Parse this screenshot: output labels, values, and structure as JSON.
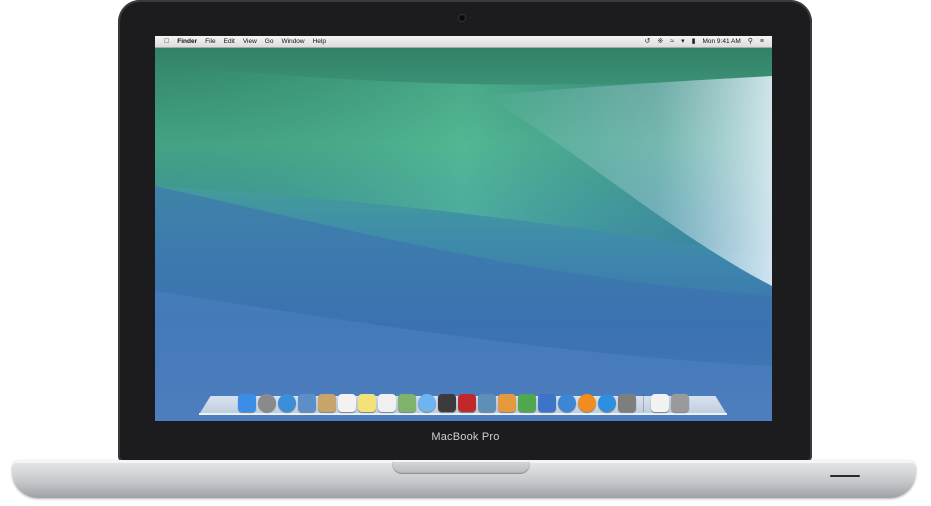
{
  "device": {
    "brand_label": "MacBook Pro"
  },
  "menubar": {
    "apple_icon": "apple-icon",
    "app_name": "Finder",
    "menus": [
      "File",
      "Edit",
      "View",
      "Go",
      "Window",
      "Help"
    ],
    "status_icons": [
      "time-machine-icon",
      "bluetooth-icon",
      "wifi-icon",
      "volume-icon",
      "battery-icon"
    ],
    "clock": "Mon 9:41 AM",
    "spotlight_icon": "search-icon",
    "notifications_icon": "list-icon"
  },
  "dock": {
    "apps": [
      {
        "name": "finder",
        "color": "#3a8ee6"
      },
      {
        "name": "launchpad",
        "color": "#8a8a8a"
      },
      {
        "name": "safari",
        "color": "#3b8fd9"
      },
      {
        "name": "mail",
        "color": "#5c8ec9"
      },
      {
        "name": "contacts",
        "color": "#c8a46a"
      },
      {
        "name": "calendar",
        "color": "#f2f2f2"
      },
      {
        "name": "notes",
        "color": "#f3e27a"
      },
      {
        "name": "reminders",
        "color": "#f0f0f0"
      },
      {
        "name": "maps",
        "color": "#7fb36a"
      },
      {
        "name": "messages",
        "color": "#6db4f0"
      },
      {
        "name": "facetime",
        "color": "#3b3b3b"
      },
      {
        "name": "photo-booth",
        "color": "#c0282b"
      },
      {
        "name": "iphoto",
        "color": "#5d8fb9"
      },
      {
        "name": "pages",
        "color": "#e49a3c"
      },
      {
        "name": "numbers",
        "color": "#4fa84f"
      },
      {
        "name": "keynote",
        "color": "#3e73c9"
      },
      {
        "name": "itunes",
        "color": "#3b87d6"
      },
      {
        "name": "ibooks",
        "color": "#f08d1e"
      },
      {
        "name": "app-store",
        "color": "#2e8ee0"
      },
      {
        "name": "system-preferences",
        "color": "#7e7e7e"
      },
      {
        "name": "documents",
        "color": "#f2f2f2"
      },
      {
        "name": "trash",
        "color": "#9a9a9a"
      }
    ]
  }
}
